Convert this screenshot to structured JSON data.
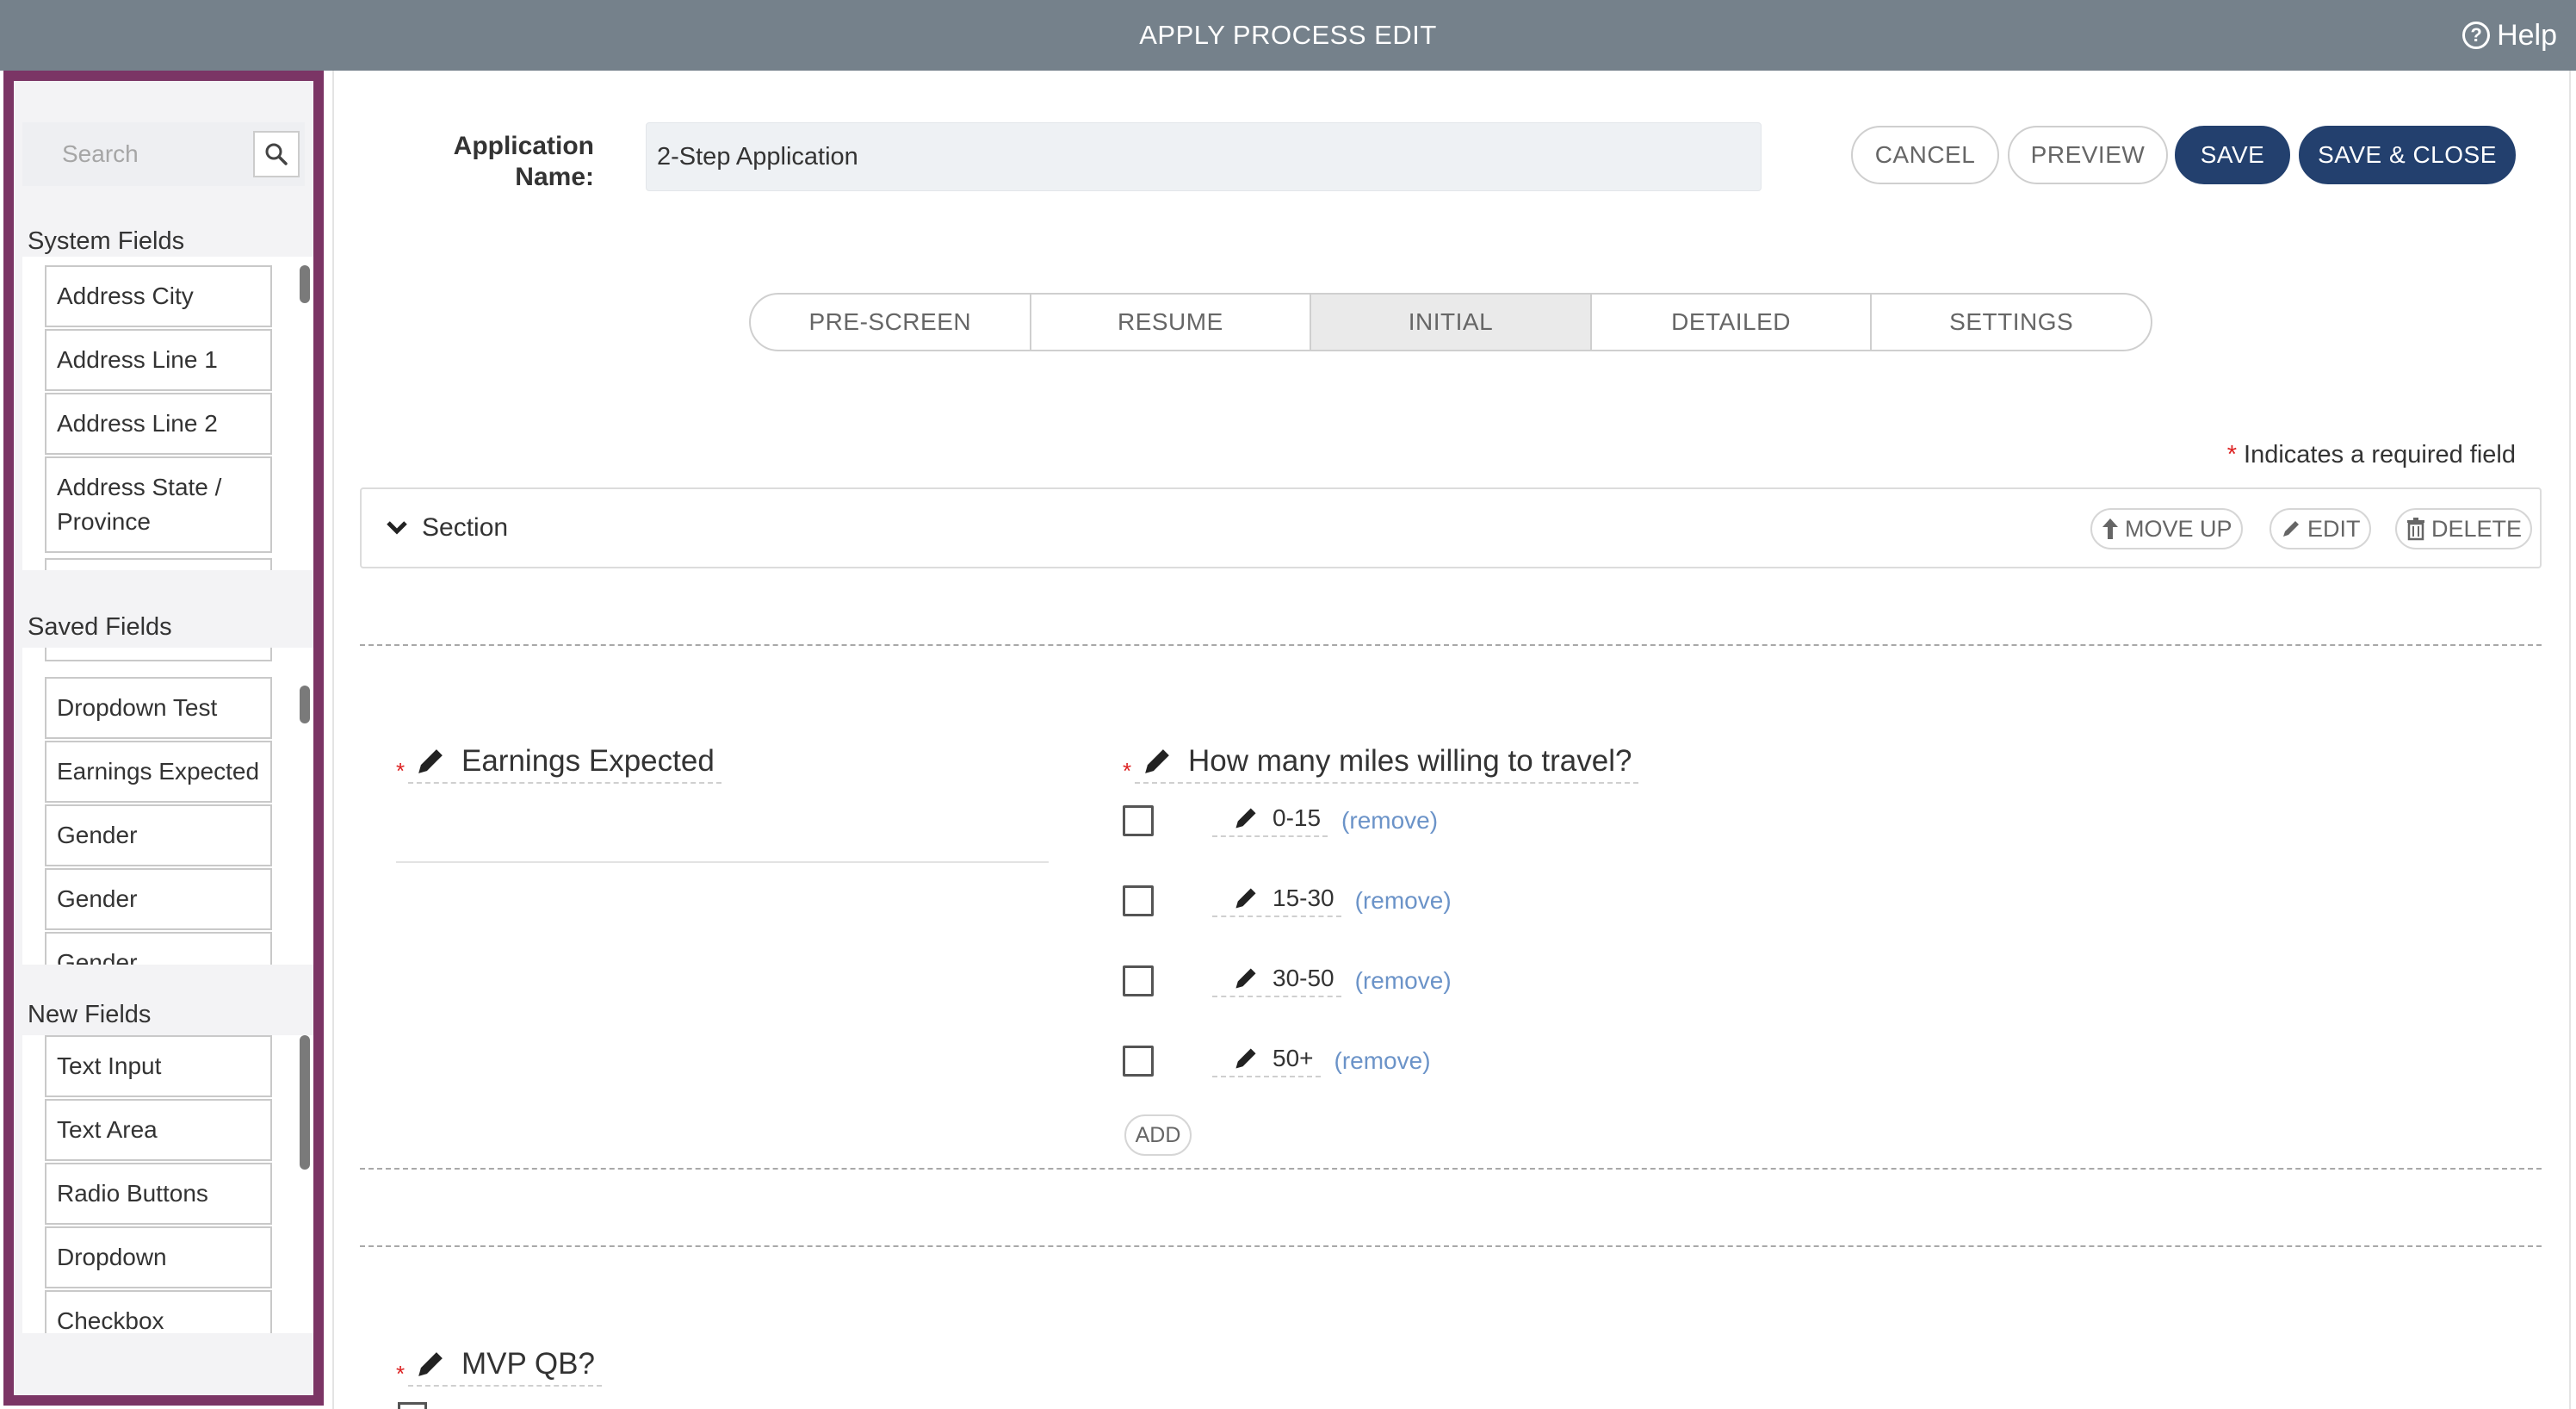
{
  "window": {
    "title": "APPLY PROCESS EDIT",
    "help_label": "Help"
  },
  "sidebar": {
    "search_placeholder": "Search",
    "system_fields": {
      "title": "System Fields",
      "items": [
        "Address City",
        "Address Line 1",
        "Address Line 2",
        "Address State / Province"
      ]
    },
    "saved_fields": {
      "title": "Saved Fields",
      "items": [
        "Dropdown Test",
        "Earnings Expected",
        "Gender",
        "Gender",
        "Gender"
      ]
    },
    "new_fields": {
      "title": "New Fields",
      "items": [
        "Text Input",
        "Text Area",
        "Radio Buttons",
        "Dropdown",
        "Checkbox"
      ]
    }
  },
  "header": {
    "app_name_label_line1": "Application",
    "app_name_label_line2": "Name:",
    "app_name_value": "2-Step Application",
    "cancel_label": "CANCEL",
    "preview_label": "PREVIEW",
    "save_label": "SAVE",
    "save_close_label": "SAVE & CLOSE"
  },
  "tabs": [
    {
      "label": "PRE-SCREEN",
      "active": false
    },
    {
      "label": "RESUME",
      "active": false
    },
    {
      "label": "INITIAL",
      "active": true
    },
    {
      "label": "DETAILED",
      "active": false
    },
    {
      "label": "SETTINGS",
      "active": false
    }
  ],
  "required_note": {
    "star": "*",
    "text": "Indicates a required field"
  },
  "section": {
    "title": "Section",
    "move_up_label": "MOVE UP",
    "edit_label": "EDIT",
    "delete_label": "DELETE"
  },
  "fields": {
    "earnings": {
      "star": "*",
      "label": "Earnings Expected"
    },
    "miles": {
      "star": "*",
      "label": "How many miles willing to travel?",
      "options": [
        "0-15",
        "15-30",
        "30-50",
        "50+"
      ],
      "remove_label": "(remove)",
      "add_label": "ADD"
    },
    "mvp": {
      "star": "*",
      "label": "MVP QB?"
    }
  },
  "colors": {
    "titlebar": "#75818b",
    "sidebar_border": "#7b3565",
    "primary_button": "#23406e",
    "required_star": "#dd2222",
    "remove_link": "#6b93c8"
  }
}
